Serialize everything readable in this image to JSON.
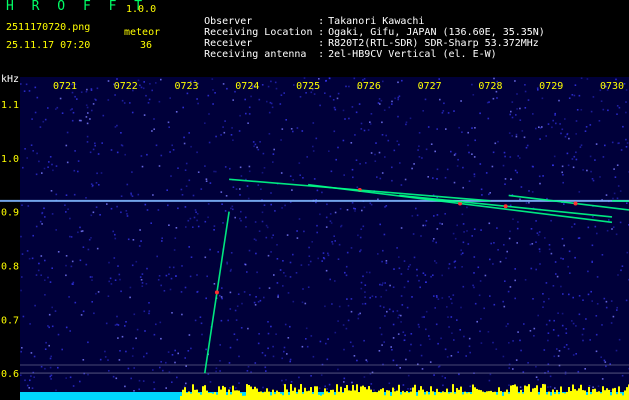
{
  "app": {
    "title": "H R O F F T",
    "version": "1.0.0",
    "file_name": "2511170720.png",
    "date_time": "25.11.17 07:20",
    "meteor_label": "meteor",
    "meteor_count": "36"
  },
  "info": [
    {
      "label": "Observer",
      "value": "Takanori Kawachi"
    },
    {
      "label": "Receiving Location",
      "value": "Ogaki, Gifu, JAPAN (136.60E, 35.35N)"
    },
    {
      "label": "Receiver",
      "value": "R820T2(RTL-SDR) SDR-Sharp 53.372MHz"
    },
    {
      "label": "Receiving antenna",
      "value": "2el-HB9CV Vertical (el. E-W)"
    }
  ],
  "chart_data": {
    "type": "heatmap",
    "y_unit": "kHz",
    "x_ticks": [
      "0721",
      "0722",
      "0723",
      "0724",
      "0725",
      "0726",
      "0727",
      "0728",
      "0729",
      "0730"
    ],
    "y_ticks": [
      "1.1",
      "1.0",
      "0.9",
      "0.8",
      "0.7",
      "0.6"
    ],
    "ylim": [
      0.55,
      1.15
    ],
    "xlim": [
      7.0,
      10.0
    ],
    "carrier_khz": 0.92,
    "meteor_echoes": [
      {
        "x_start": 7.233,
        "x_end": 7.237,
        "y_start": 0.6,
        "y_end": 0.9
      },
      {
        "x_start": 7.237,
        "x_end": 7.28,
        "y_start": 0.96,
        "y_end": 0.92
      },
      {
        "x_start": 7.25,
        "x_end": 7.3,
        "y_start": 0.95,
        "y_end": 0.88
      },
      {
        "x_start": 7.265,
        "x_end": 7.3,
        "y_start": 0.93,
        "y_end": 0.89
      },
      {
        "x_start": 7.3,
        "x_end": 7.35,
        "y_start": 0.92,
        "y_end": 0.91
      },
      {
        "x_start": 7.283,
        "x_end": 7.305,
        "y_start": 0.93,
        "y_end": 0.9
      }
    ],
    "grid": true,
    "colors": {
      "background": "#00003a",
      "noise": "#3a3aff",
      "carrier": "#7fb6ff",
      "echo_hot": "#ff3030",
      "echo_mid": "#00ff88",
      "axis_text": "#ffff00",
      "axis_label": "#ffffff",
      "bottom_bar": "#ffff00"
    }
  }
}
